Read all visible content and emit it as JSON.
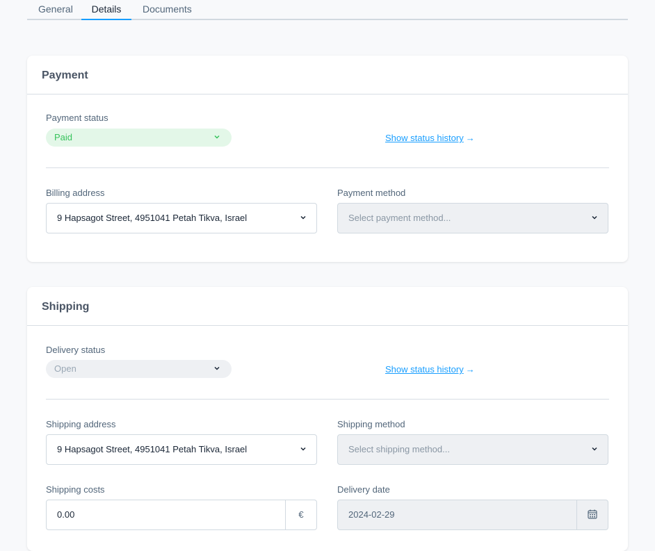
{
  "tabs": {
    "general": "General",
    "details": "Details",
    "documents": "Documents"
  },
  "payment": {
    "title": "Payment",
    "status_label": "Payment status",
    "status_value": "Paid",
    "history_link": "Show status history",
    "billing_label": "Billing address",
    "billing_value": "9 Hapsagot Street, 4951041 Petah Tikva, Israel",
    "method_label": "Payment method",
    "method_placeholder": "Select payment method..."
  },
  "shipping": {
    "title": "Shipping",
    "status_label": "Delivery status",
    "status_value": "Open",
    "history_link": "Show status history",
    "address_label": "Shipping address",
    "address_value": "9 Hapsagot Street, 4951041 Petah Tikva, Israel",
    "method_label": "Shipping method",
    "method_placeholder": "Select shipping method...",
    "costs_label": "Shipping costs",
    "costs_value": "0.00",
    "currency_symbol": "€",
    "date_label": "Delivery date",
    "date_value": "2024-02-29"
  },
  "icons": {
    "arrow": "→",
    "chevron": "chevron-down-icon",
    "calendar": "calendar-icon"
  },
  "colors": {
    "accent": "#189eff",
    "paid_bg": "#e3f7e8",
    "paid_text": "#37c35c"
  }
}
